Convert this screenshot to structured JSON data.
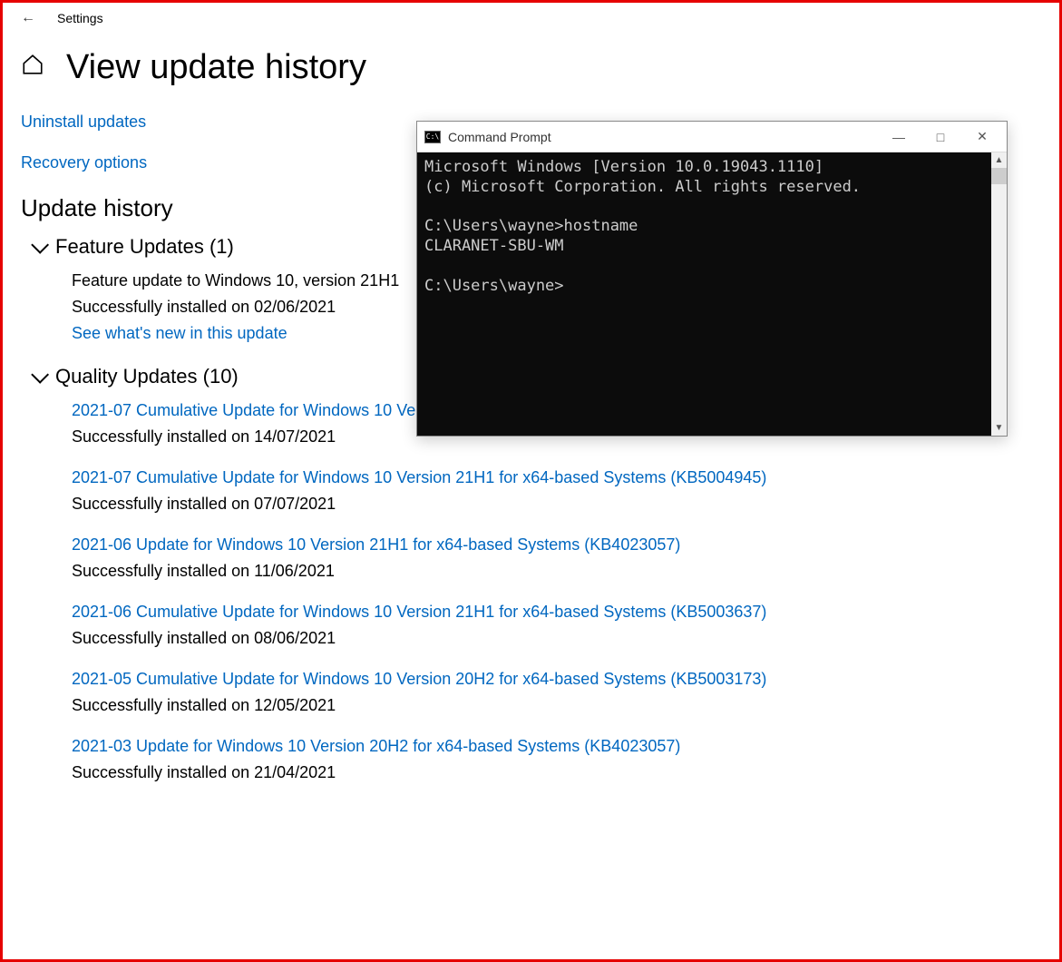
{
  "topbar": {
    "settings_label": "Settings"
  },
  "header": {
    "title": "View update history"
  },
  "links": {
    "uninstall": "Uninstall updates",
    "recovery": "Recovery options"
  },
  "history": {
    "heading": "Update history",
    "feature": {
      "header": "Feature Updates (1)",
      "items": [
        {
          "title": "Feature update to Windows 10, version 21H1",
          "status": "Successfully installed on 02/06/2021",
          "link": "See what's new in this update"
        }
      ]
    },
    "quality": {
      "header": "Quality Updates (10)",
      "items": [
        {
          "title": "2021-07 Cumulative Update for Windows 10 Version 21H1 for x64-based Systems (KB5004237)",
          "status": "Successfully installed on 14/07/2021"
        },
        {
          "title": "2021-07 Cumulative Update for Windows 10 Version 21H1 for x64-based Systems (KB5004945)",
          "status": "Successfully installed on 07/07/2021"
        },
        {
          "title": "2021-06 Update for Windows 10 Version 21H1 for x64-based Systems (KB4023057)",
          "status": "Successfully installed on 11/06/2021"
        },
        {
          "title": "2021-06 Cumulative Update for Windows 10 Version 21H1 for x64-based Systems (KB5003637)",
          "status": "Successfully installed on 08/06/2021"
        },
        {
          "title": "2021-05 Cumulative Update for Windows 10 Version 20H2 for x64-based Systems (KB5003173)",
          "status": "Successfully installed on 12/05/2021"
        },
        {
          "title": "2021-03 Update for Windows 10 Version 20H2 for x64-based Systems (KB4023057)",
          "status": "Successfully installed on 21/04/2021"
        }
      ]
    }
  },
  "cmd": {
    "title": "Command Prompt",
    "lines": "Microsoft Windows [Version 10.0.19043.1110]\n(c) Microsoft Corporation. All rights reserved.\n\nC:\\Users\\wayne>hostname\nCLARANET-SBU-WM\n\nC:\\Users\\wayne>"
  }
}
